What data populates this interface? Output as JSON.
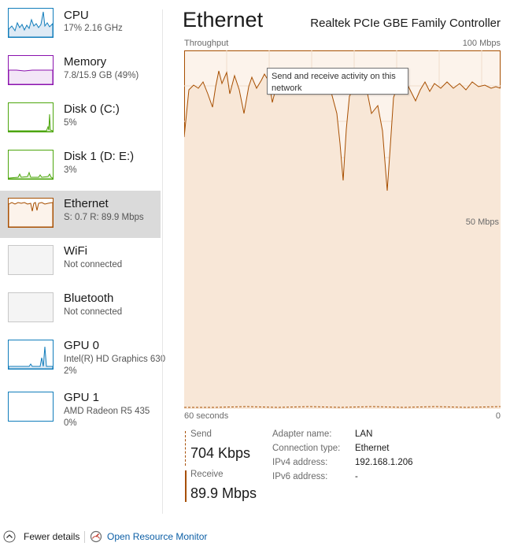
{
  "sidebar": {
    "items": [
      {
        "name": "CPU",
        "sub": "17%  2.16 GHz",
        "color": "#117dbb",
        "icon": "cpu-graph"
      },
      {
        "name": "Memory",
        "sub": "7.8/15.9 GB (49%)",
        "color": "#8b12ae",
        "icon": "memory-graph"
      },
      {
        "name": "Disk 0 (C:)",
        "sub": "5%",
        "color": "#4da60c",
        "icon": "disk-graph"
      },
      {
        "name": "Disk 1 (D: E:)",
        "sub": "3%",
        "color": "#4da60c",
        "icon": "disk-graph"
      },
      {
        "name": "Ethernet",
        "sub": "S: 0.7  R: 89.9 Mbps",
        "color": "#a74f01",
        "icon": "ethernet-graph"
      },
      {
        "name": "WiFi",
        "sub": "Not connected",
        "color": "#c8c8c8",
        "icon": "wifi-graph"
      },
      {
        "name": "Bluetooth",
        "sub": "Not connected",
        "color": "#c8c8c8",
        "icon": "bluetooth-graph"
      },
      {
        "name": "GPU 0",
        "sub": "Intel(R) HD Graphics 630",
        "sub2": "2%",
        "color": "#117dbb",
        "icon": "gpu-graph"
      },
      {
        "name": "GPU 1",
        "sub": "AMD Radeon R5 435",
        "sub2": "0%",
        "color": "#117dbb",
        "icon": "gpu-graph"
      }
    ],
    "selected": "Ethernet"
  },
  "main": {
    "title": "Ethernet",
    "adapter": "Realtek PCIe GBE Family Controller",
    "graph_label": "Throughput",
    "max_label": "100 Mbps",
    "mid_label": "50 Mbps",
    "time_label": "60 seconds",
    "zero_label": "0",
    "accent": "#a74f01",
    "fill": "#fcf3eb",
    "tooltip": "Send and receive activity on this network"
  },
  "stats": {
    "send_label": "Send",
    "send_value": "704 Kbps",
    "receive_label": "Receive",
    "receive_value": "89.9 Mbps"
  },
  "info": [
    {
      "label": "Adapter name:",
      "value": "LAN"
    },
    {
      "label": "Connection type:",
      "value": "Ethernet"
    },
    {
      "label": "IPv4 address:",
      "value": "192.168.1.206"
    },
    {
      "label": "IPv6 address:",
      "value": "-"
    }
  ],
  "footer": {
    "fewer_details": "Fewer details",
    "resource_monitor": "Open Resource Monitor"
  }
}
